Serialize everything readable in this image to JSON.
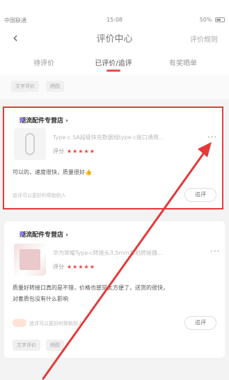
{
  "status": {
    "carrier": "中国联通",
    "time": "15:08",
    "battery": "50%"
  },
  "nav": {
    "back": "‹",
    "title": "评价中心",
    "right": "评价规则"
  },
  "tabs": [
    {
      "label": "待评价",
      "active": false
    },
    {
      "label": "已评价/追评",
      "active": true
    },
    {
      "label": "有奖晒单",
      "active": false
    }
  ],
  "strip": {
    "pill1": "文字评价",
    "pill2": "晒图"
  },
  "card1": {
    "shop": "潮流配件专营店",
    "product": "Type-c 5A超级快充数据线type-c接口通用...",
    "rating_label": "评分",
    "stars": "★★★★★",
    "comment": "可以的，速度很快，质量很好👍",
    "footer": "追评可以更好的帮助别人",
    "append": "追评",
    "more": "···"
  },
  "card2": {
    "shop": "潮流配件专营店",
    "product": "华为荣耀Type-c转接头3.5mm耳机转接器...",
    "rating_label": "评分",
    "stars": "★★★★★",
    "comment_line1": "质量好转接口真的是不错，价格也感觉太方便了，送货的很快，",
    "comment_line2": "对套质包没有什么影响",
    "footer": "追评可以更好的帮助别人",
    "append": "追评",
    "more": "···"
  },
  "strip2": {
    "pill1": "文字评价",
    "pill2": "晒图"
  },
  "colors": {
    "accent": "#e84d4d",
    "highlight": "#e53939",
    "arrow": "#e53939"
  }
}
